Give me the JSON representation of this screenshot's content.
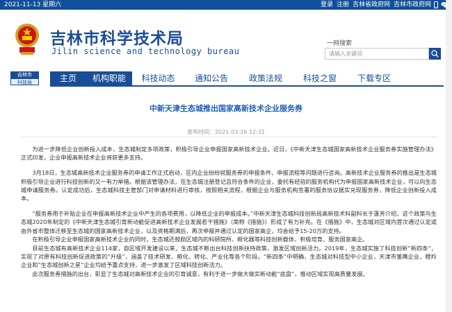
{
  "topbar": {
    "date": "2021-11-13 星期六",
    "links": [
      "登录",
      "注册",
      "吉林省政府网",
      "吉林市政府网"
    ],
    "icons": [
      "mobile-icon",
      "wechat-icon"
    ]
  },
  "header": {
    "title": "吉林市科学技术局",
    "subtitle": "Jilin science and technology bureau",
    "emblem": "national-emblem",
    "search_label": "一网搜索",
    "search_placeholder": "请输入关键词"
  },
  "nav": {
    "side_label_top": "吉林市",
    "side_label_bottom": "科技局",
    "items": [
      {
        "label": "主页",
        "active": true
      },
      {
        "label": "机构职能",
        "active": true
      },
      {
        "label": "科技动态",
        "active": false
      },
      {
        "label": "通知公告",
        "active": false
      },
      {
        "label": "政策法规",
        "active": false
      },
      {
        "label": "科技之窗",
        "active": false
      },
      {
        "label": "下载专区",
        "active": false
      }
    ]
  },
  "article": {
    "title": "中新天津生态城推出国家高新技术企业服务券",
    "meta": "发布时间：2021-03-26 12:31",
    "paragraphs": [
      "为进一步降低企业创新投入成本，生态城制定多项政策，积极引导企业申报国家高新技术企业。近日，《中新天津生态城国家高新技术企业服务券实施管理办法》正式印发，企业申报高新技术企业将获更多支持。",
      "3月18日，生态城高新技术企业服务券的申请工作正式启动，区内企业纷纷就服务券的申报条件、申报流程等问题进行咨询。高新技术企业服务券的推出是生态城积极引导企业进行科技创新的又一有力举措。根据该管理办法，在生态城注册登记且符合条件的企业，委托有经验的服务机构代为申报国家高新技术企业，可以向生态城申请服务券。认定成功后，生态城科技主管部门对申请材料进行审核，按照相关流程，根据企业与服务机构签署的服务协议据实兑现服务券，降低企业创新投入成本。",
      "“服务券用于补贴企业在申报高新技术企业中产生的各项费用，以降低企业的申报成本。”中新天津生态城科技创新局高新技术科副科长于蓬芳介绍，这个政策与生态城2020年制定的《中新天津生态城引育新动能促进高新技术企业发展若干措施》（简称《措施》）形成了有力补充。在《措施》中，生态城对区域内首次通过认定或由外省市整体迁移至生态城的国家高新技术企业，以及资格期满后，再次申报并通过认定的国家高企，均会给予15-20万的支持。",
      "在积极引导企业申报国家高新技术企业的同时，生态城还鼓励区域内的科研院所、孵化器等科技创新载体，积极培育、服务国家高企。",
      "目前生态城有高新技术企业114家，自区域开发建设以来，生态城不断出台科技创新扶持政策，激发区域创新活力。2019年，生态城实施了科技创新“新四条”，实现了对原有科技创新促进政策的“升级”，涵盖了技术研发、孵化、转化、产业化等各个阶段。“新四条”中明确，生态城对科技型中小企业，天津市雏鹰企业、瞪羚企业和“生态城创新之星”企业均给予重点支持，进一步激发了区域科技创新活力。",
      "此次服务券措施的出台，彰显了生态城对高新技术企业的引育诚意，有利于进一步做大做实新动能“底盘”，推动区域实现高质量发展。"
    ]
  },
  "colors": {
    "brand_blue": "#1a4d97",
    "topbar_blue": "#114f98",
    "title_blue": "#1d5fb4"
  }
}
